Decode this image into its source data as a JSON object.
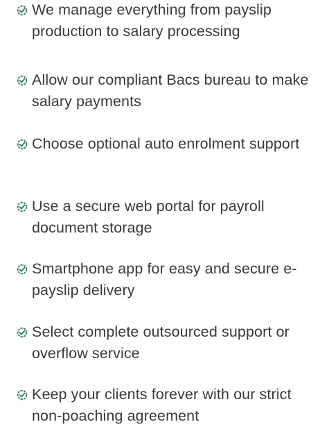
{
  "accent_color": "#2e7d5b",
  "features": {
    "icon": "badge-check-icon",
    "items": [
      {
        "text": "We manage everything from payslip production to salary processing"
      },
      {
        "text": "Allow our compliant Bacs bureau to make salary payments"
      },
      {
        "text": "Choose optional auto enrolment support"
      },
      {
        "text": "Use a secure web portal for payroll document storage"
      },
      {
        "text": "Smartphone app for easy and secure e-payslip delivery"
      },
      {
        "text": "Select complete outsourced support or overflow service"
      },
      {
        "text": "Keep your clients forever with our strict non-poaching agreement"
      }
    ]
  }
}
